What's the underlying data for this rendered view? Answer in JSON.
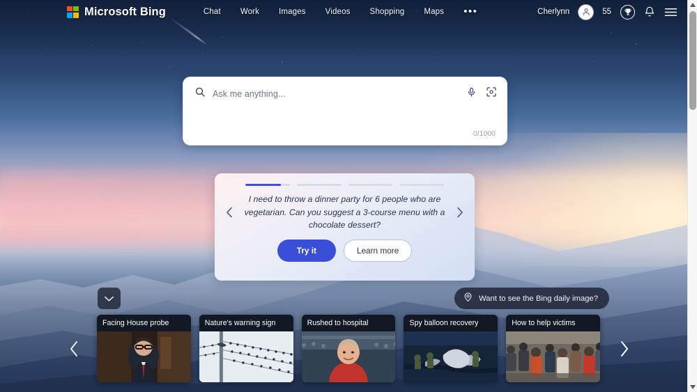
{
  "header": {
    "brand": "Microsoft Bing",
    "logo_icon": "microsoft-logo-icon",
    "logo_colors": [
      "#f25022",
      "#7fba00",
      "#00a4ef",
      "#ffb900"
    ],
    "nav": [
      {
        "label": "Chat",
        "name": "nav-chat"
      },
      {
        "label": "Work",
        "name": "nav-work"
      },
      {
        "label": "Images",
        "name": "nav-images"
      },
      {
        "label": "Videos",
        "name": "nav-videos"
      },
      {
        "label": "Shopping",
        "name": "nav-shopping"
      },
      {
        "label": "Maps",
        "name": "nav-maps"
      }
    ],
    "more_label": "•••",
    "user_name": "Cherlynn",
    "avatar_icon": "user-avatar-icon",
    "rewards_points": "55",
    "rewards_icon": "trophy-icon",
    "notifications_icon": "bell-icon",
    "menu_icon": "hamburger-menu-icon"
  },
  "search": {
    "placeholder": "Ask me anything...",
    "value": "",
    "char_count": "0/1000",
    "search_icon": "search-icon",
    "mic_icon": "microphone-icon",
    "camera_icon": "visual-search-camera-icon"
  },
  "suggestion": {
    "progress": [
      80,
      0,
      0,
      0
    ],
    "prompt": "I need to throw a dinner party for 6 people who are vegetarian. Can you suggest a 3-course menu with a chocolate dessert?",
    "try_label": "Try it",
    "learn_label": "Learn more",
    "prev_icon": "chevron-left-icon",
    "next_icon": "chevron-right-icon",
    "accent_color": "#3b4ed8"
  },
  "bottom": {
    "collapse_icon": "chevron-down-icon",
    "daily_image_label": "Want to see the Bing daily image?",
    "daily_image_icon": "location-pin-icon",
    "carousel_prev_icon": "chevron-left-icon",
    "carousel_next_icon": "chevron-right-icon"
  },
  "news": {
    "cards": [
      {
        "title": "Facing House probe",
        "thumb": "man-in-suit-glasses-hearing"
      },
      {
        "title": "Nature's warning sign",
        "thumb": "birds-on-power-lines"
      },
      {
        "title": "Rushed to hospital",
        "thumb": "man-red-shirt-stadium"
      },
      {
        "title": "Spy balloon recovery",
        "thumb": "sailors-recovering-debris-at-sea"
      },
      {
        "title": "How to help victims",
        "thumb": "crowd-receiving-aid"
      }
    ]
  },
  "scrollbar": {
    "up_icon": "scroll-up-arrow-icon",
    "down_icon": "scroll-down-arrow-icon",
    "thumb": "scrollbar-thumb"
  }
}
